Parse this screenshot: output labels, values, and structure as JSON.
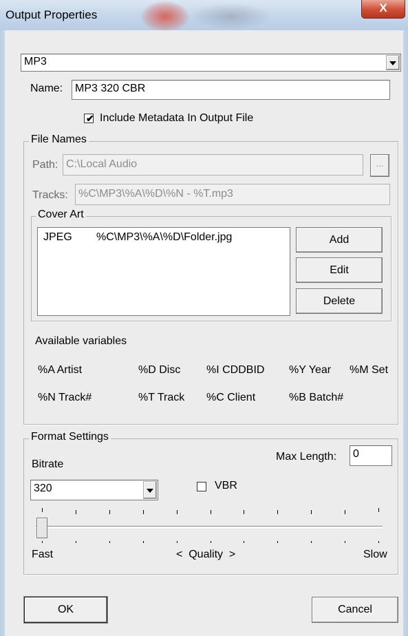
{
  "window": {
    "title": "Output Properties",
    "close_glyph": "X"
  },
  "format_select": {
    "value": "MP3"
  },
  "name": {
    "label": "Name:",
    "value": "MP3 320 CBR"
  },
  "include_metadata": {
    "label": "Include Metadata In Output File",
    "checked": true
  },
  "file_names": {
    "group_label": "File Names",
    "path_label": "Path:",
    "path_value": "C:\\Local Audio",
    "browse_label": "...",
    "tracks_label": "Tracks:",
    "tracks_value": "%C\\MP3\\%A\\%D\\%N - %T.mp3",
    "cover_art": {
      "group_label": "Cover Art",
      "items": [
        {
          "type": "JPEG",
          "path": "%C\\MP3\\%A\\%D\\Folder.jpg"
        }
      ],
      "add_label": "Add",
      "edit_label": "Edit",
      "delete_label": "Delete"
    },
    "variables_label": "Available variables",
    "variables": [
      [
        "%A Artist",
        "%D Disc",
        "%I CDDBID",
        "%Y Year",
        "%M Set"
      ],
      [
        "%N Track#",
        "%T Track",
        "%C Client",
        "%B Batch#"
      ]
    ]
  },
  "format_settings": {
    "group_label": "Format Settings",
    "bitrate_label": "Bitrate",
    "bitrate_value": "320",
    "vbr_label": "VBR",
    "vbr_checked": false,
    "max_length_label": "Max Length:",
    "max_length_value": "0",
    "quality_fast": "Fast",
    "quality_label": "<  Quality  >",
    "quality_slow": "Slow",
    "quality_position": 0
  },
  "buttons": {
    "ok_label": "OK",
    "cancel_label": "Cancel"
  },
  "colors": {
    "title_gradient": "#c4d6ea",
    "close_button": "#d0533a",
    "dialog_bg": "#ececec"
  }
}
